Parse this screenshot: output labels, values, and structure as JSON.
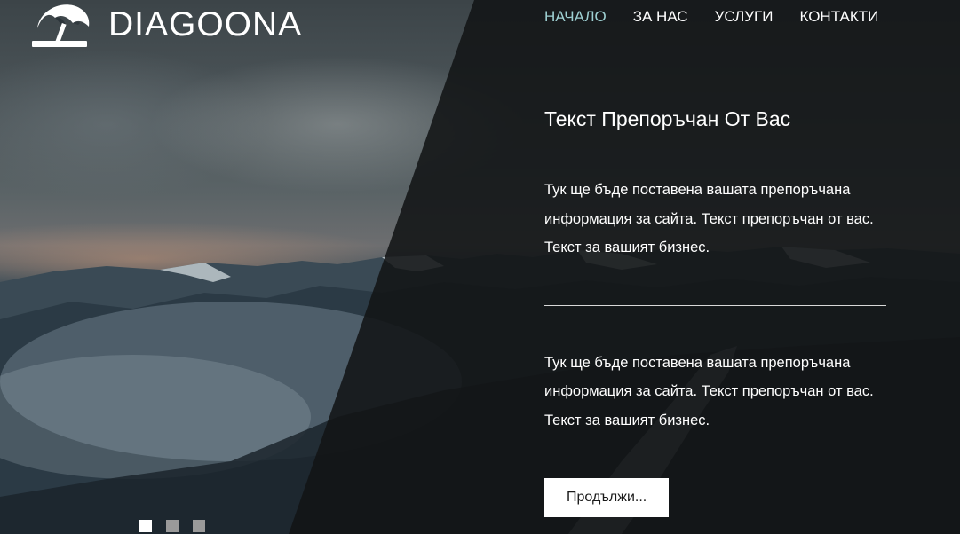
{
  "brand": {
    "name": "DIAGOONA",
    "logo_icon": "beach-umbrella-icon"
  },
  "nav": {
    "items": [
      {
        "label": "НАЧАЛО",
        "active": true
      },
      {
        "label": "ЗА НАС",
        "active": false
      },
      {
        "label": "УСЛУГИ",
        "active": false
      },
      {
        "label": "КОНТАКТИ",
        "active": false
      }
    ]
  },
  "hero": {
    "headline": "Текст Препоръчан От Вас",
    "paragraph_1": "Тук ще бъде поставена вашата препоръчана информация за сайта. Текст препоръчан от вас. Текст за вашият бизнес.",
    "paragraph_2": "Тук ще бъде поставена вашата препоръчана информация за сайта. Текст препоръчан от вас. Текст за вашият бизнес.",
    "cta_label": "Продължи..."
  },
  "slider": {
    "slide_count": 3,
    "active_index": 0
  },
  "colors": {
    "nav_active": "#9ed0d2",
    "text": "#ffffff",
    "overlay": "#121416",
    "dot_inactive": "#9a9a9a"
  }
}
